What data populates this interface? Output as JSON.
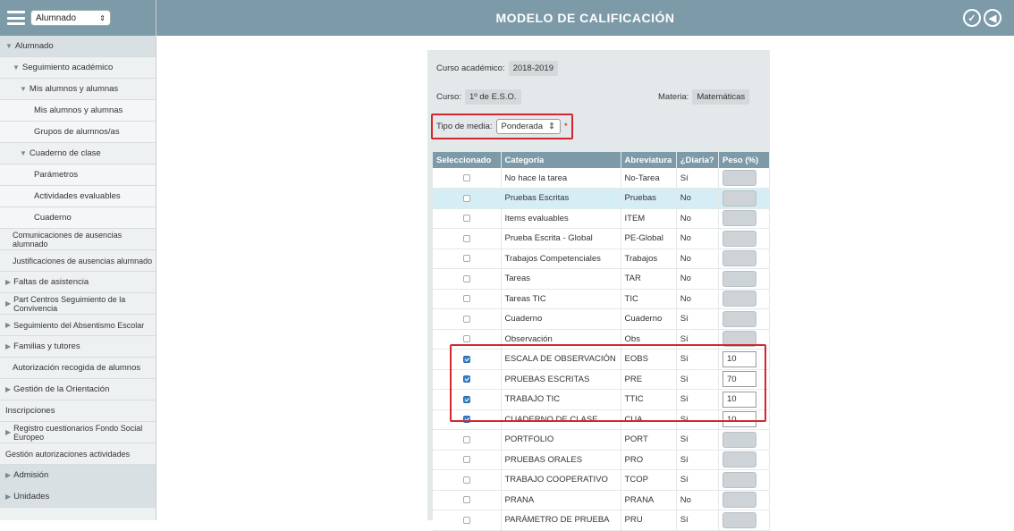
{
  "header": {
    "title": "MODELO DE CALIFICACIÓN",
    "accept_icon": "✓",
    "back_icon": "◀"
  },
  "sidebar": {
    "role_select": "Alumnado",
    "items": [
      {
        "label": "Alumnado",
        "level": 0,
        "type": "section",
        "expander": "▼"
      },
      {
        "label": "Seguimiento académico",
        "level": 1,
        "expander": "▼"
      },
      {
        "label": "Mis alumnos y alumnas",
        "level": 2,
        "expander": "▼"
      },
      {
        "label": "Mis alumnos y alumnas",
        "level": 3
      },
      {
        "label": "Grupos de alumnos/as",
        "level": 3
      },
      {
        "label": "Cuaderno de clase",
        "level": 2,
        "expander": "▼"
      },
      {
        "label": "Parámetros",
        "level": 3
      },
      {
        "label": "Actividades evaluables",
        "level": 3
      },
      {
        "label": "Cuaderno",
        "level": 3
      },
      {
        "label": "Comunicaciones de ausencias alumnado",
        "level": 1,
        "two": true
      },
      {
        "label": "Justificaciones de ausencias alumnado",
        "level": 1,
        "two": true
      },
      {
        "label": "Faltas de asistencia",
        "level": 0,
        "expander": "▶"
      },
      {
        "label": "Part Centros Seguimiento de la Convivencia",
        "level": 0,
        "expander": "▶",
        "two": true
      },
      {
        "label": "Seguimiento del Absentismo Escolar",
        "level": 0,
        "expander": "▶",
        "two": true
      },
      {
        "label": "Familias y tutores",
        "level": 0,
        "expander": "▶"
      },
      {
        "label": "Autorización recogida de alumnos",
        "level": 1
      },
      {
        "label": "Gestión de la Orientación",
        "level": 0,
        "expander": "▶"
      },
      {
        "label": "Inscripciones",
        "level": 0
      },
      {
        "label": "Registro cuestionarios Fondo Social Europeo",
        "level": 0,
        "expander": "▶",
        "two": true
      },
      {
        "label": "Gestión autorizaciones actividades",
        "level": 0,
        "two": true
      },
      {
        "label": "Admisión",
        "level": 0,
        "type": "section",
        "expander": "▶"
      },
      {
        "label": "Unidades",
        "level": 0,
        "type": "section",
        "expander": "▶"
      }
    ]
  },
  "form": {
    "curso_academico_label": "Curso académico:",
    "curso_academico_value": "2018-2019",
    "curso_label": "Curso:",
    "curso_value": "1º de E.S.O.",
    "materia_label": "Materia:",
    "materia_value": "Matemáticas",
    "tipo_media_label": "Tipo de media:",
    "tipo_media_value": "Ponderada",
    "tipo_media_arrow": "⇕",
    "required_mark": "*"
  },
  "table": {
    "headers": [
      "Seleccionado",
      "Categoría",
      "Abreviatura",
      "¿Diaria?",
      "Peso (%)"
    ],
    "rows": [
      {
        "selected": false,
        "categoria": "No hace la tarea",
        "abrev": "No-Tarea",
        "diaria": "Sí",
        "peso": ""
      },
      {
        "selected": false,
        "categoria": "Pruebas Escritas",
        "abrev": "Pruebas",
        "diaria": "No",
        "peso": "",
        "highlight": true
      },
      {
        "selected": false,
        "categoria": "Items evaluables",
        "abrev": "ITEM",
        "diaria": "No",
        "peso": ""
      },
      {
        "selected": false,
        "categoria": "Prueba Escrita - Global",
        "abrev": "PE-Global",
        "diaria": "No",
        "peso": ""
      },
      {
        "selected": false,
        "categoria": "Trabajos Competenciales",
        "abrev": "Trabajos",
        "diaria": "No",
        "peso": ""
      },
      {
        "selected": false,
        "categoria": "Tareas",
        "abrev": "TAR",
        "diaria": "No",
        "peso": ""
      },
      {
        "selected": false,
        "categoria": "Tareas TIC",
        "abrev": "TIC",
        "diaria": "No",
        "peso": ""
      },
      {
        "selected": false,
        "categoria": "Cuaderno",
        "abrev": "Cuaderno",
        "diaria": "Sí",
        "peso": ""
      },
      {
        "selected": false,
        "categoria": "Observación",
        "abrev": "Obs",
        "diaria": "Sí",
        "peso": ""
      },
      {
        "selected": true,
        "categoria": "ESCALA DE OBSERVACIÓN",
        "abrev": "EOBS",
        "diaria": "Sí",
        "peso": "10"
      },
      {
        "selected": true,
        "categoria": "PRUEBAS ESCRITAS",
        "abrev": "PRE",
        "diaria": "Sí",
        "peso": "70"
      },
      {
        "selected": true,
        "categoria": "TRABAJO TIC",
        "abrev": "TTIC",
        "diaria": "Sí",
        "peso": "10"
      },
      {
        "selected": true,
        "categoria": "CUADERNO DE CLASE",
        "abrev": "CUA",
        "diaria": "Sí",
        "peso": "10"
      },
      {
        "selected": false,
        "categoria": "PORTFOLIO",
        "abrev": "PORT",
        "diaria": "Sí",
        "peso": ""
      },
      {
        "selected": false,
        "categoria": "PRUEBAS ORALES",
        "abrev": "PRO",
        "diaria": "Sí",
        "peso": ""
      },
      {
        "selected": false,
        "categoria": "TRABAJO COOPERATIVO",
        "abrev": "TCOP",
        "diaria": "Sí",
        "peso": ""
      },
      {
        "selected": false,
        "categoria": "PRANA",
        "abrev": "PRANA",
        "diaria": "No",
        "peso": ""
      },
      {
        "selected": false,
        "categoria": "PARÁMETRO DE PRUEBA",
        "abrev": "PRU",
        "diaria": "Sí",
        "peso": ""
      }
    ]
  },
  "colors": {
    "header_bg": "#7d9aa8",
    "highlight_red": "#d3262e",
    "row_highlight": "#d5eef5",
    "checkbox_on": "#3a83c9"
  }
}
